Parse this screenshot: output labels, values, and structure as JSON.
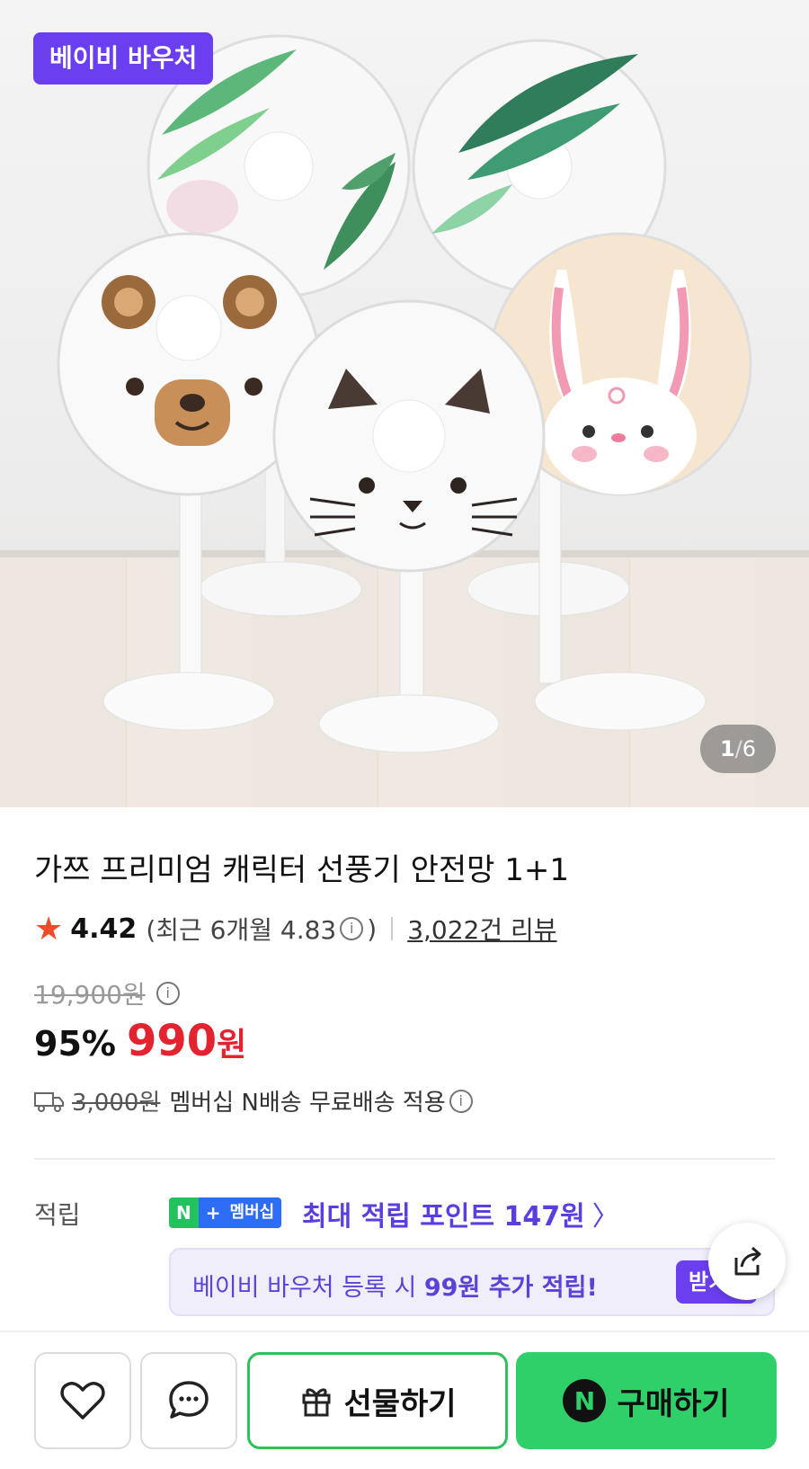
{
  "hero": {
    "badge": "베이비 바우처",
    "counter_current": "1",
    "counter_sep": "/",
    "counter_total": "6"
  },
  "product": {
    "title": "가쯔 프리미엄 캐릭터 선풍기 안전망 1+1",
    "rating": "4.42",
    "recent_rating": "(최근 6개월 4.83",
    "recent_close": ")",
    "reviews": "3,022건 리뷰",
    "original_price": "19,900원",
    "discount": "95%",
    "price": "990",
    "price_unit": "원"
  },
  "shipping": {
    "original_fee": "3,000원",
    "text": "멤버십 N배송 무료배송 적용"
  },
  "points": {
    "label": "적립",
    "badge_n": "N",
    "badge_plus": "+",
    "badge_text": "멤버십",
    "text": "최대 적립 포인트 147원",
    "chevron": "〉"
  },
  "voucher": {
    "text_prefix": "베이비 바우처 등록 시 ",
    "amount": "99원 추가 적립!",
    "button": "받기"
  },
  "bottom": {
    "gift_label": "선물하기",
    "buy_n": "N",
    "buy_label": "구매하기"
  },
  "colors": {
    "accent_purple": "#6b3ff0",
    "price_red": "#e3232f",
    "naver_green": "#2fd06a"
  }
}
